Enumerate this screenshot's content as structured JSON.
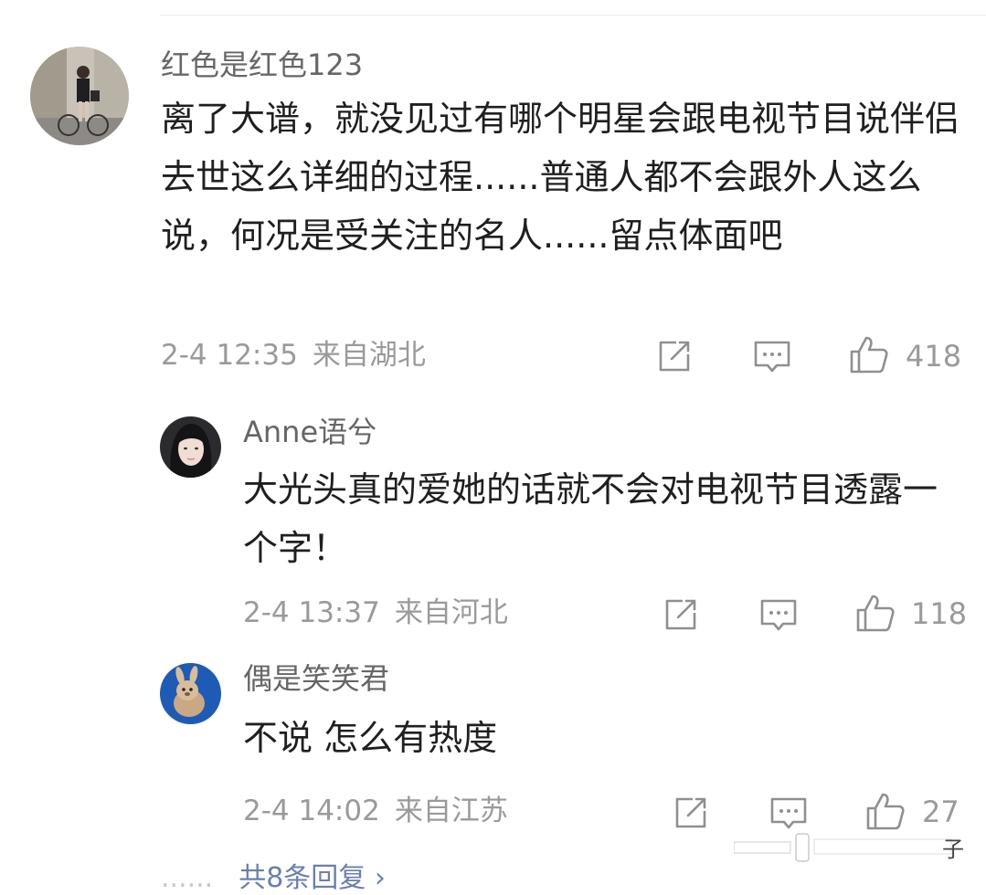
{
  "comments": [
    {
      "username": "红色是红色123",
      "text": "离了大谱，就没见过有哪个明星会跟电视节目说伴侣去世这么详细的过程......普通人都不会跟外人这么说，何况是受关注的名人......留点体面吧",
      "time": "2-4 12:35",
      "location": "来自湖北",
      "likes": "418"
    },
    {
      "username": "Anne语兮",
      "text": "大光头真的爱她的话就不会对电视节目透露一个字！",
      "time": "2-4 13:37",
      "location": "来自河北",
      "likes": "118"
    },
    {
      "username": "偶是笑笑君",
      "text": "不说 怎么有热度",
      "time": "2-4 14:02",
      "location": "来自江苏",
      "likes": "27"
    }
  ],
  "footer": {
    "dots": "......",
    "replies_label": "共8条回复 ›"
  },
  "watermark": "子",
  "icons": [
    "share-icon",
    "comment-icon",
    "like-icon"
  ],
  "colors": {
    "text": "#1f1f1f",
    "meta": "#9a9a9a",
    "username": "#666666",
    "reply_link": "#6a7fae"
  }
}
